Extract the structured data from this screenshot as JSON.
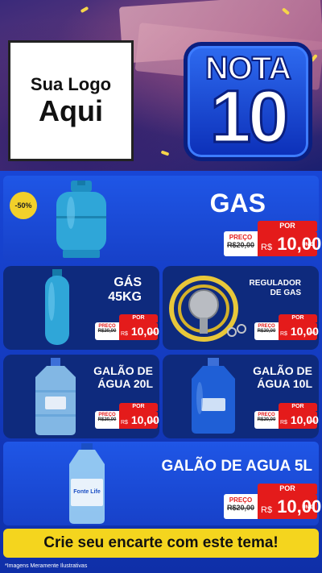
{
  "header": {
    "logo_line1": "Sua Logo",
    "logo_line2": "Aqui",
    "nota_word": "NOTA",
    "nota_number": "10"
  },
  "products": [
    {
      "title": "GAS",
      "badge": "-50%",
      "price": {
        "por": "POR",
        "preco": "PREÇO",
        "old": "R$20,00",
        "currency": "R$",
        "value": "10,00",
        "unit": "UNID"
      }
    },
    {
      "title_l1": "GÁS",
      "title_l2": "45KG",
      "price": {
        "por": "POR",
        "preco": "PREÇO",
        "old": "R$20,00",
        "currency": "R$",
        "value": "10,00",
        "unit": "UNID"
      }
    },
    {
      "title_l1": "REGULADOR",
      "title_l2": "DE GAS",
      "price": {
        "por": "POR",
        "preco": "PREÇO",
        "old": "R$20,00",
        "currency": "R$",
        "value": "10,00",
        "unit": "UNID"
      }
    },
    {
      "title_l1": "GALÃO DE",
      "title_l2": "ÁGUA 20L",
      "price": {
        "por": "POR",
        "preco": "PREÇO",
        "old": "R$20,00",
        "currency": "R$",
        "value": "10,00",
        "unit": "UNID"
      }
    },
    {
      "title_l1": "GALÃO DE",
      "title_l2": "ÁGUA 10L",
      "price": {
        "por": "POR",
        "preco": "PREÇO",
        "old": "R$20,00",
        "currency": "R$",
        "value": "10,00",
        "unit": "UNID"
      }
    },
    {
      "title": "GALÃO DE AGUA 5L",
      "price": {
        "por": "POR",
        "preco": "PREÇO",
        "old": "R$20,00",
        "currency": "R$",
        "value": "10,00",
        "unit": "UNID"
      }
    }
  ],
  "water_brand": "Fonte Life",
  "cta": "Crie seu encarte com este tema!",
  "footer_note": "*Imagens Meramente Ilustrativas",
  "colors": {
    "primary_blue": "#1846d6",
    "price_red": "#e41b1b",
    "cta_yellow": "#f4d51e",
    "card_navy": "#0e2a7d"
  }
}
